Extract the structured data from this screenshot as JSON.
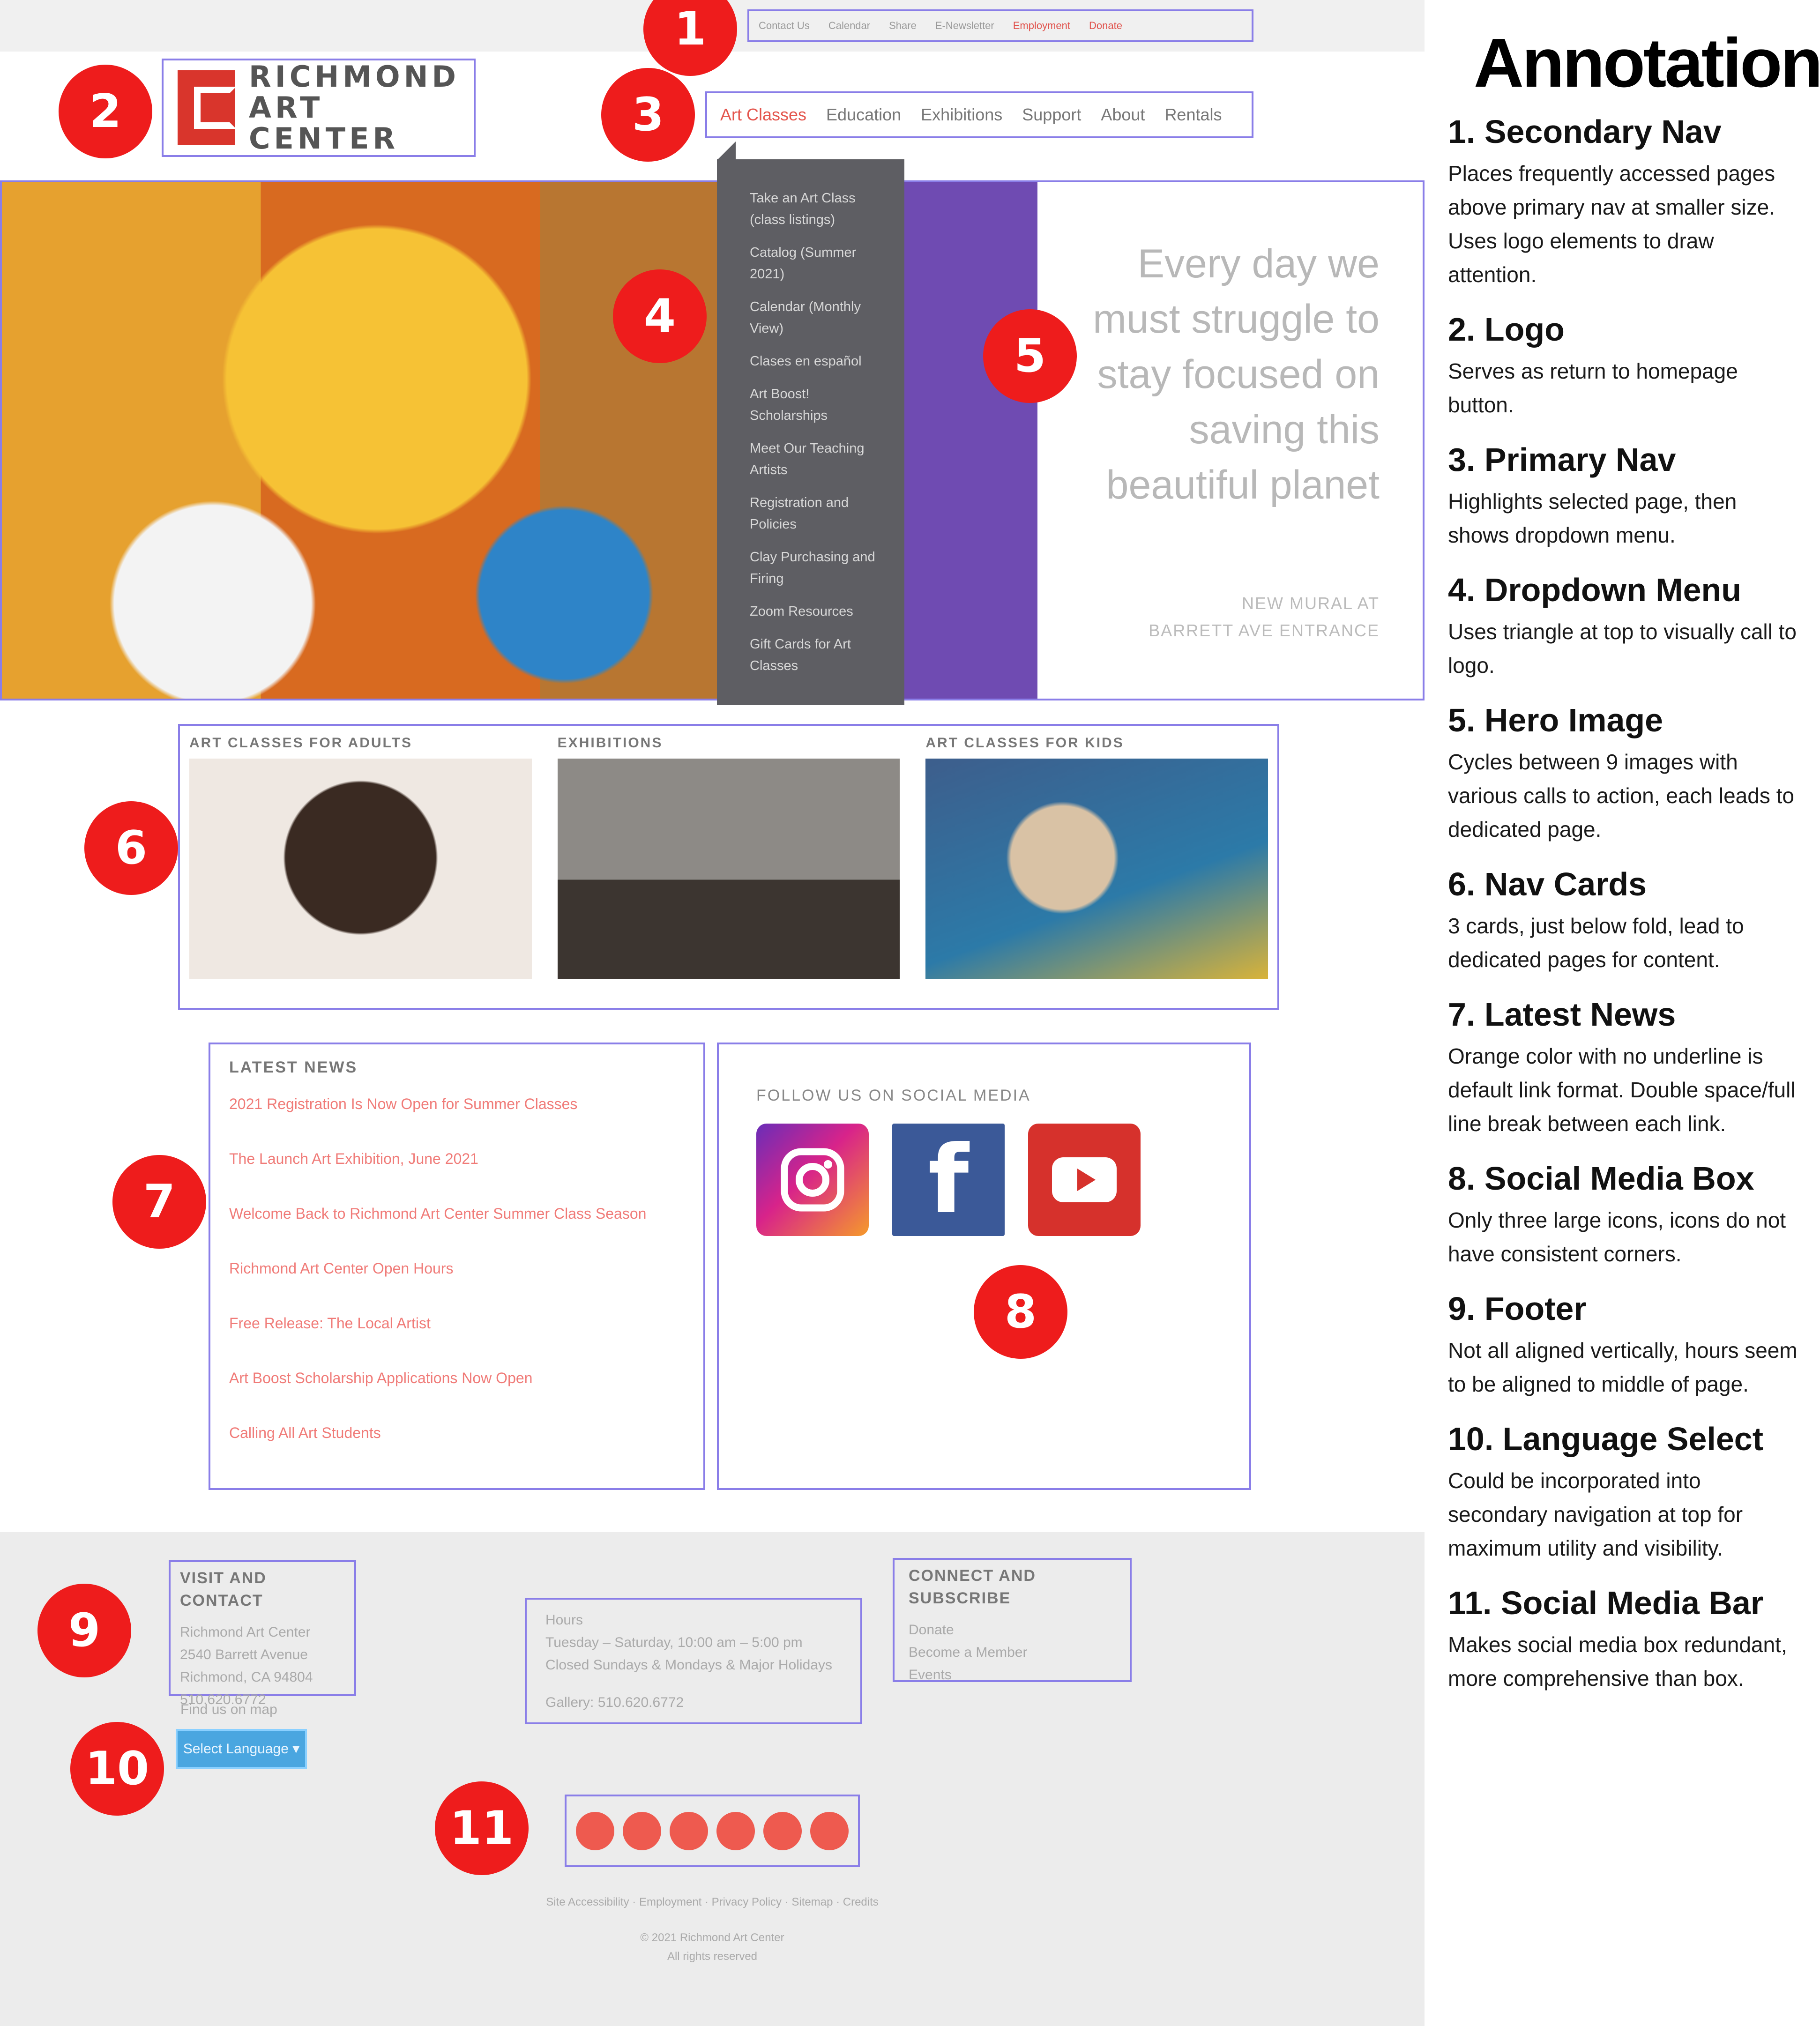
{
  "secondary_nav": {
    "items": [
      "Contact Us",
      "Calendar",
      "Share",
      "E-Newsletter",
      "Employment",
      "Donate"
    ]
  },
  "logo": {
    "line1": "RICHMOND",
    "line2": "ART CENTER"
  },
  "primary_nav": {
    "items": [
      "Art Classes",
      "Education",
      "Exhibitions",
      "Support",
      "About",
      "Rentals"
    ],
    "active": "Art Classes"
  },
  "dropdown": {
    "items": [
      "Take an Art Class (class listings)",
      "Catalog (Summer 2021)",
      "Calendar (Monthly View)",
      "Clases en español",
      "Art Boost! Scholarships",
      "Meet Our Teaching Artists",
      "Registration and Policies",
      "Clay Purchasing and Firing",
      "Zoom Resources",
      "Gift Cards for Art Classes"
    ]
  },
  "hero": {
    "quote": "Every day we must struggle to stay focused on saving this beautiful planet",
    "caption_line1": "NEW MURAL AT",
    "caption_line2": "BARRETT AVE ENTRANCE"
  },
  "nav_cards": {
    "items": [
      "ART CLASSES FOR ADULTS",
      "EXHIBITIONS",
      "ART CLASSES FOR KIDS"
    ]
  },
  "news": {
    "title": "LATEST NEWS",
    "items": [
      "2021 Registration Is Now Open for Summer Classes",
      "The Launch Art Exhibition, June 2021",
      "Welcome Back to Richmond Art Center Summer Class Season",
      "Richmond Art Center Open Hours",
      "Free Release: The Local Artist",
      "Art Boost Scholarship Applications Now Open",
      "Calling All Art Students"
    ]
  },
  "social_box": {
    "title": "FOLLOW US ON SOCIAL MEDIA",
    "icons": [
      "instagram-icon",
      "facebook-icon",
      "youtube-icon"
    ]
  },
  "footer": {
    "visit_title": "VISIT AND CONTACT",
    "visit_lines": [
      "Richmond Art Center",
      "2540 Barrett Avenue",
      "Richmond, CA 94804",
      "510.620.6772"
    ],
    "find_us": "Find us on map",
    "hours_title": "Hours",
    "hours_lines": [
      "Tuesday – Saturday, 10:00 am – 5:00 pm",
      "Closed Sundays & Mondays & Major Holidays",
      "",
      "Gallery: 510.620.6772"
    ],
    "links_title": "CONNECT AND SUBSCRIBE",
    "links_lines": [
      "Donate",
      "Become a Member",
      "Events"
    ],
    "language": "Select Language ▾",
    "fineprint1": "Site Accessibility · Employment · Privacy Policy · Sitemap · Credits",
    "fineprint2": "© 2021 Richmond Art Center",
    "fineprint3": "All rights reserved"
  },
  "annotations": {
    "heading": "Annotations",
    "items": [
      {
        "title": "1. Secondary Nav",
        "desc": "Places frequently accessed pages above primary nav at smaller size. Uses logo elements to draw attention."
      },
      {
        "title": "2. Logo",
        "desc": "Serves as return to homepage button."
      },
      {
        "title": "3. Primary Nav",
        "desc": "Highlights selected page, then shows dropdown menu."
      },
      {
        "title": "4. Dropdown Menu",
        "desc": "Uses triangle at top to visually call to logo."
      },
      {
        "title": "5. Hero Image",
        "desc": "Cycles between 9 images with various calls to action, each leads to dedicated page."
      },
      {
        "title": "6. Nav Cards",
        "desc": "3 cards, just below fold, lead to dedicated pages for content."
      },
      {
        "title": "7. Latest News",
        "desc": "Orange color with no underline is default link format. Double space/full line break between each link."
      },
      {
        "title": "8. Social Media Box",
        "desc": "Only three large icons, icons do not have consistent corners."
      },
      {
        "title": "9. Footer",
        "desc": "Not all aligned vertically, hours seem to be aligned to middle of page."
      },
      {
        "title": "10. Language Select",
        "desc": "Could be incorporated into secondary navigation at top for maximum utility and visibility."
      },
      {
        "title": "11. Social Media Bar",
        "desc": "Makes social media box redundant, more comprehensive than box."
      }
    ]
  },
  "markers": [
    "1",
    "2",
    "3",
    "4",
    "5",
    "6",
    "7",
    "8",
    "9",
    "10",
    "11"
  ],
  "colors": {
    "accent": "#e4554d",
    "marker": "#ee1c1c",
    "outline": "#8a7ee8",
    "dropdown": "#5e5e63",
    "footer": "#ececec",
    "language": "#4aa6e0"
  }
}
